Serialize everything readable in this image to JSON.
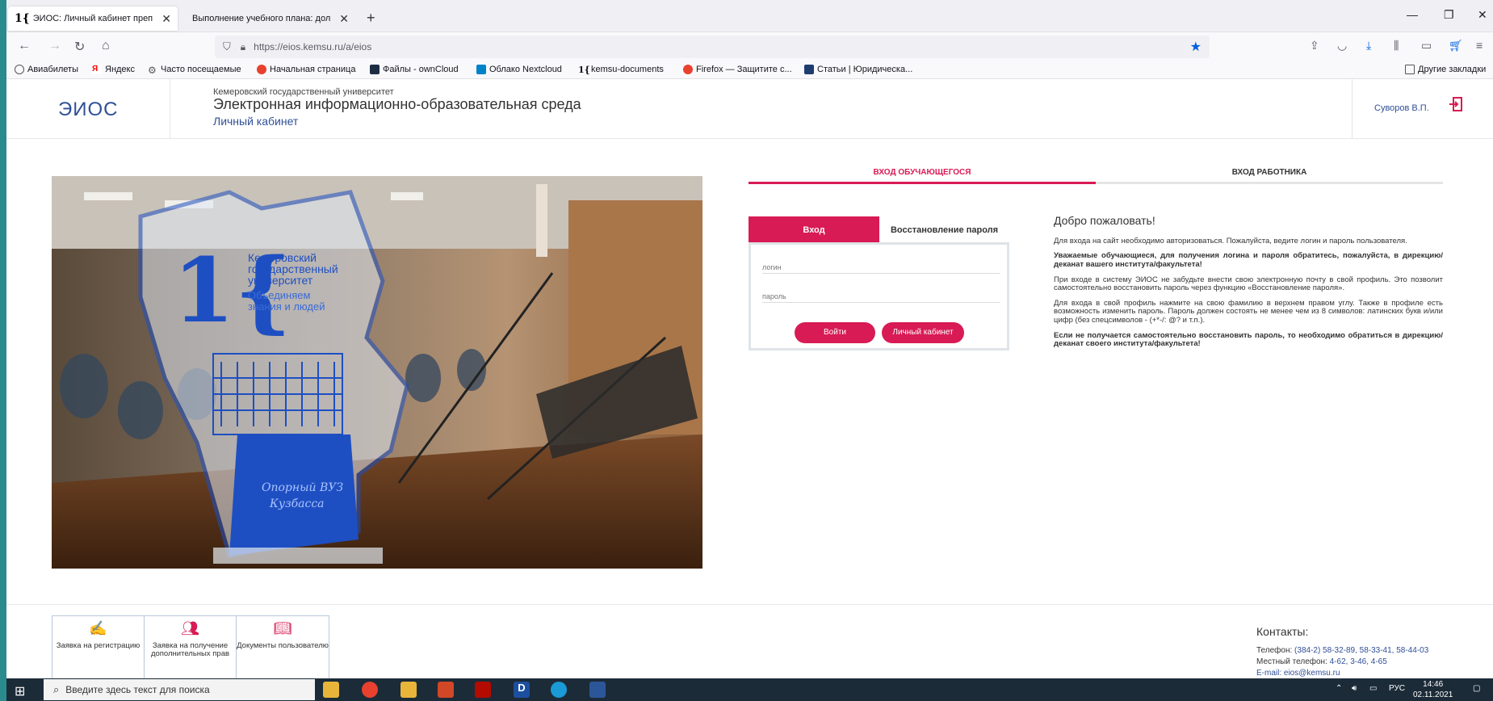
{
  "browser": {
    "tabs": [
      {
        "title": "ЭИОС: Личный кабинет преп"
      },
      {
        "title": "Выполнение учебного плана: дол"
      }
    ],
    "url": "https://eios.kemsu.ru/a/eios",
    "bookmarks": [
      "Авиабилеты",
      "Яндекс",
      "Часто посещаемые",
      "Начальная страница",
      "Файлы - ownCloud",
      "Облако Nextcloud",
      "kemsu-documents",
      "Firefox — Защитите с...",
      "Статьи | Юридическа...",
      "Другие закладки"
    ]
  },
  "header": {
    "logo": "ЭИОС",
    "university": "Кемеровский государственный университет",
    "title": "Электронная информационно-образовательная среда",
    "subtitle": "Личный кабинет",
    "user": "Суворов В.П."
  },
  "photo": {
    "line1": "Кемеровский",
    "line2": "государственный",
    "line3": "университет",
    "line4": "Объединяем",
    "line5": "знания и людей",
    "base_text1": "Опорный ВУЗ",
    "base_text2": "Кузбасса"
  },
  "login_tabs": {
    "student": "ВХОД ОБУЧАЮЩЕГОСЯ",
    "employee": "ВХОД РАБОТНИКА"
  },
  "login": {
    "tab_login": "Вход",
    "tab_recover": "Восстановление пароля",
    "login_placeholder": "логин",
    "password_placeholder": "пароль",
    "btn_login": "Войти",
    "btn_cabinet": "Личный кабинет"
  },
  "welcome": {
    "title": "Добро пожаловать!",
    "p1": "Для входа на сайт необходимо авторизоваться. Пожалуйста, ведите логин и пароль пользователя.",
    "p2": "Уважаемые обучающиеся, для получения логина и пароля обратитесь, пожалуйста, в дирекцию/деканат вашего института/факультета!",
    "p3": "При входе в систему ЭИОС не забудьте внести свою электронную почту в свой профиль. Это позволит самостоятельно восстановить пароль через функцию «Восстановление пароля».",
    "p4": "Для входа в свой профиль нажмите на свою фамилию в верхнем правом углу. Также в профиле есть возможность изменить пароль. Пароль должен состоять не менее чем из 8 символов: латинских букв и/или цифр (без спецсимволов - (+*-/: @? и т.п.).",
    "p5": "Если не получается самостоятельно восстановить пароль, то необходимо обратиться в дирекцию/деканат своего института/факультета!"
  },
  "tiles": [
    {
      "label": "Заявка на регистрацию"
    },
    {
      "label": "Заявка на получение дополнительных прав"
    },
    {
      "label": "Документы пользователю"
    }
  ],
  "contacts": {
    "title": "Контакты:",
    "phone_label": "Телефон:",
    "phone": "(384-2) 58-32-89, 58-33-41, 58-44-03",
    "local_label": "Местный телефон:",
    "local": "4-62, 3-46, 4-65",
    "email": "E-mail: eios@kemsu.ru"
  },
  "taskbar": {
    "search_placeholder": "Введите здесь текст для поиска",
    "lang": "РУС",
    "time": "14:46",
    "date": "02.11.2021"
  }
}
